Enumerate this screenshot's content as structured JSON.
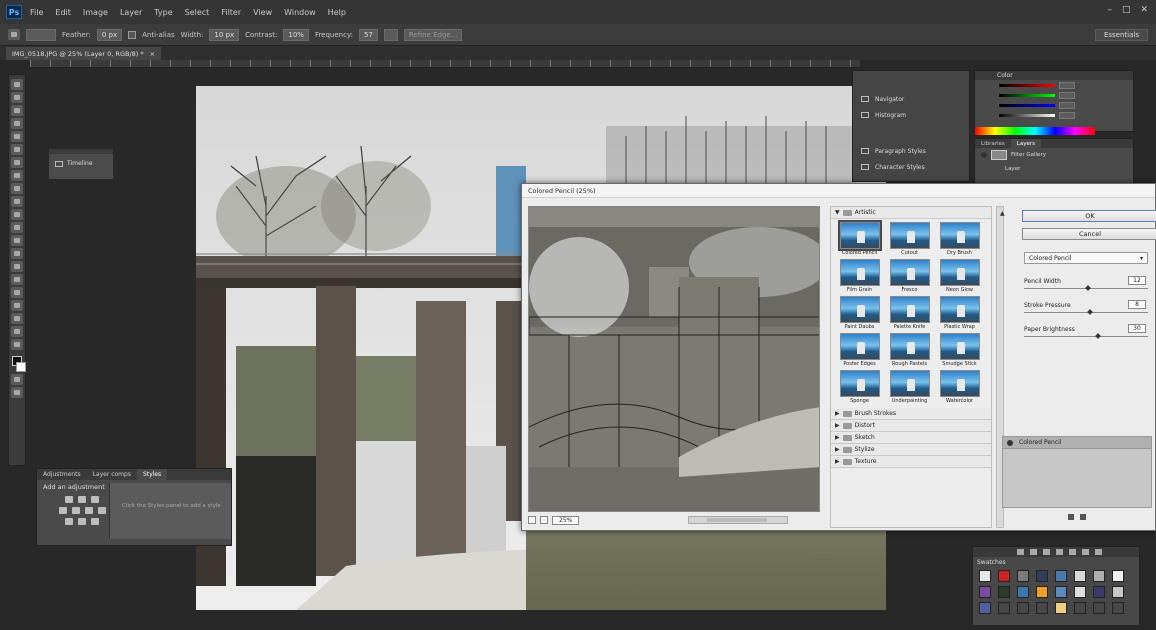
{
  "app": {
    "logo": "Ps",
    "menu": [
      "File",
      "Edit",
      "Image",
      "Layer",
      "Type",
      "Select",
      "Filter",
      "View",
      "Window",
      "Help"
    ],
    "window_controls": [
      "–",
      "□",
      "✕"
    ]
  },
  "options_bar": {
    "feather_label": "Feather:",
    "feather_value": "0 px",
    "antialias_label": "Anti-alias",
    "width_label": "Width:",
    "width_value": "10 px",
    "contrast_label": "Contrast:",
    "contrast_value": "10%",
    "frequency_label": "Frequency:",
    "frequency_value": "57",
    "refine_label": "Refine Edge...",
    "workspace": "Essentials"
  },
  "document": {
    "tab_title": "IMG_0518.JPG @ 25% (Layer 0, RGB/8) *",
    "tab_close": "×"
  },
  "timeline_panel": {
    "label": "Timeline"
  },
  "adjustments_panel": {
    "tabs": [
      "Adjustments",
      "Layer comps",
      "Styles"
    ],
    "title": "Add an adjustment",
    "list_text": "Click the Styles panel to add a style"
  },
  "navigator_panel": {
    "items": [
      "Navigator",
      "Histogram",
      "Paragraph Styles",
      "Character Styles"
    ]
  },
  "color_panel": {
    "tab": "Color"
  },
  "layers_panel": {
    "tabs": [
      "Libraries",
      "Layers"
    ],
    "layer_name": "Filter Gallery",
    "sublayer": "Layer"
  },
  "swatches_panel": {
    "tab": "Swatches",
    "colors": [
      "#e8e8e8",
      "#cc2222",
      "#7a7a7a",
      "#2d3d5a",
      "#4a7ab0",
      "#d8d8d8",
      "#b0b0b0",
      "#f2f2f2",
      "#7a4aa0",
      "#2a3a2a",
      "#3a7ab0",
      "#f2a020",
      "#5a8ac0",
      "#e0e0e0",
      "#3a3a6a",
      "#c8c8c8",
      "#5060a0",
      "#484848",
      "#484848",
      "#484848",
      "#f0d080",
      "#484848",
      "#484848",
      "#484848"
    ]
  },
  "dialog": {
    "title": "Colored Pencil (25%)",
    "zoom": "25%",
    "categories_top": {
      "name": "Artistic"
    },
    "filters": [
      {
        "label": "Colored Pencil",
        "selected": true
      },
      {
        "label": "Cutout",
        "selected": false
      },
      {
        "label": "Dry Brush",
        "selected": false
      },
      {
        "label": "Film Grain",
        "selected": false
      },
      {
        "label": "Fresco",
        "selected": false
      },
      {
        "label": "Neon Glow",
        "selected": false
      },
      {
        "label": "Paint Daubs",
        "selected": false
      },
      {
        "label": "Palette Knife",
        "selected": false
      },
      {
        "label": "Plastic Wrap",
        "selected": false
      },
      {
        "label": "Poster Edges",
        "selected": false
      },
      {
        "label": "Rough Pastels",
        "selected": false
      },
      {
        "label": "Smudge Stick",
        "selected": false
      },
      {
        "label": "Sponge",
        "selected": false
      },
      {
        "label": "Underpainting",
        "selected": false
      },
      {
        "label": "Watercolor",
        "selected": false
      }
    ],
    "categories_bottom": [
      "Brush Strokes",
      "Distort",
      "Sketch",
      "Stylize",
      "Texture"
    ],
    "ok_label": "OK",
    "cancel_label": "Cancel",
    "selected_filter": "Colored Pencil",
    "params": [
      {
        "label": "Pencil Width",
        "value": "12",
        "fraction": 0.52
      },
      {
        "label": "Stroke Pressure",
        "value": "8",
        "fraction": 0.53
      },
      {
        "label": "Paper Brightness",
        "value": "30",
        "fraction": 0.6
      }
    ],
    "effect_layer": "Colored Pencil"
  }
}
